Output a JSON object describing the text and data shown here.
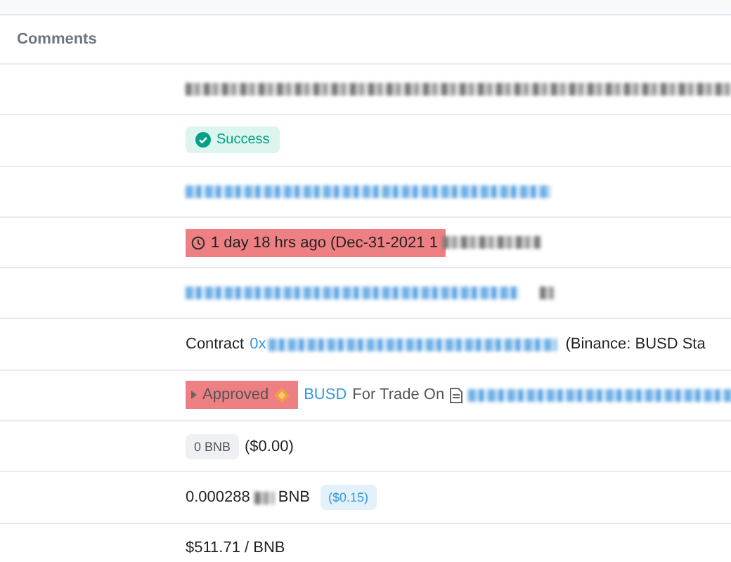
{
  "section": {
    "title": "Comments"
  },
  "rows": [
    {
      "kind": "redacted"
    },
    {
      "kind": "status",
      "label": "Success"
    },
    {
      "kind": "redacted_link"
    },
    {
      "kind": "timestamp",
      "text": "1 day 18 hrs ago (Dec-31-2021 1",
      "highlighted": true
    },
    {
      "kind": "redacted_link_copy"
    },
    {
      "kind": "contract",
      "label": "Contract",
      "address": "0x",
      "note": "(Binance: BUSD Sta"
    },
    {
      "kind": "token_action",
      "action": "Approved",
      "highlighted": true,
      "token": "BUSD",
      "text": "For Trade On"
    },
    {
      "kind": "amount",
      "badge": "0 BNB",
      "usd": "($0.00)"
    },
    {
      "kind": "fee",
      "amount": "0.000288",
      "unit": "BNB",
      "usd": "($0.15)"
    },
    {
      "kind": "price",
      "text": "$511.71 / BNB"
    }
  ]
}
